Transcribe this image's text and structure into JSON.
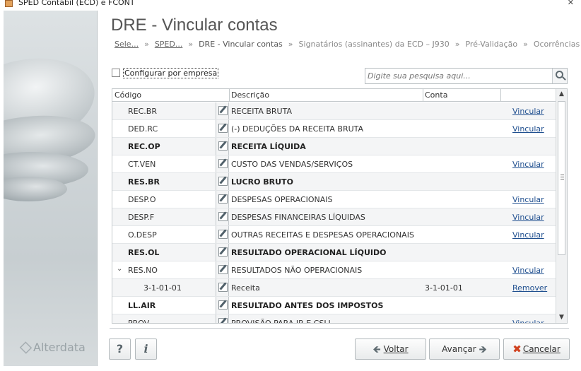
{
  "window": {
    "title": "SPED Contábil (ECD) e FCONT",
    "close_glyph": "✕"
  },
  "brand": {
    "name": "Alterdata"
  },
  "header": {
    "title": "DRE - Vincular contas",
    "breadcrumb": [
      {
        "label": "Sele...",
        "link": true
      },
      {
        "label": "SPED...",
        "link": true
      },
      {
        "label": "DRE - Vincular contas",
        "current": true
      },
      {
        "label": "Signatários (assinantes) da ECD – J930"
      },
      {
        "label": "Pré-Validação"
      },
      {
        "label": "Ocorrências"
      }
    ],
    "separator": "»"
  },
  "options": {
    "config_label": "Configurar por empresa",
    "config_checked": false,
    "search_placeholder": "Digite sua pesquisa aqui..."
  },
  "grid": {
    "columns": {
      "codigo": "Código",
      "descricao": "Descrição",
      "conta": "Conta"
    },
    "rows": [
      {
        "code": "REC.BR",
        "desc": "RECEITA BRUTA",
        "conta": "",
        "action": "Vincular",
        "bold": false,
        "alt": true
      },
      {
        "code": "DED.RC",
        "desc": "(-) DEDUÇÕES DA RECEITA BRUTA",
        "conta": "",
        "action": "Vincular",
        "bold": false,
        "alt": false
      },
      {
        "code": "REC.OP",
        "desc": "RECEITA LÍQUIDA",
        "conta": "",
        "action": "",
        "bold": true,
        "alt": true
      },
      {
        "code": "CT.VEN",
        "desc": "CUSTO DAS VENDAS/SERVIÇOS",
        "conta": "",
        "action": "Vincular",
        "bold": false,
        "alt": false
      },
      {
        "code": "RES.BR",
        "desc": "LUCRO BRUTO",
        "conta": "",
        "action": "",
        "bold": true,
        "alt": true
      },
      {
        "code": "DESP.O",
        "desc": "DESPESAS OPERACIONAIS",
        "conta": "",
        "action": "Vincular",
        "bold": false,
        "alt": false
      },
      {
        "code": "DESP.F",
        "desc": "DESPESAS FINANCEIRAS LÍQUIDAS",
        "conta": "",
        "action": "Vincular",
        "bold": false,
        "alt": true
      },
      {
        "code": "O.DESP",
        "desc": "OUTRAS RECEITAS E DESPESAS OPERACIONAIS",
        "conta": "",
        "action": "Vincular",
        "bold": false,
        "alt": false
      },
      {
        "code": "RES.OL",
        "desc": "RESULTADO OPERACIONAL LÍQUIDO",
        "conta": "",
        "action": "",
        "bold": true,
        "alt": true
      },
      {
        "code": "RES.NO",
        "desc": "RESULTADOS NÃO OPERACIONAIS",
        "conta": "",
        "action": "Vincular",
        "bold": false,
        "alt": false,
        "expanded": true
      },
      {
        "code": "3-1-01-01",
        "desc": "Receita",
        "conta": "3-1-01-01",
        "action": "Remover",
        "bold": false,
        "alt": true,
        "child": true
      },
      {
        "code": "LL.AIR",
        "desc": "RESULTADO ANTES DOS IMPOSTOS",
        "conta": "",
        "action": "",
        "bold": true,
        "alt": false
      },
      {
        "code": "PROV",
        "desc": "PROVISÃO PARA IR E CSLL",
        "conta": "",
        "action": "Vincular",
        "bold": false,
        "alt": true
      }
    ]
  },
  "footer": {
    "help_label": "?",
    "info_label": "i",
    "voltar_label": "Voltar",
    "avancar_label": "Avançar",
    "cancelar_label": "Cancelar",
    "arrow_left": "🡸",
    "arrow_right": "🡺"
  },
  "colors": {
    "link": "#1f4f8f",
    "cancel_icon": "#d0411f"
  }
}
